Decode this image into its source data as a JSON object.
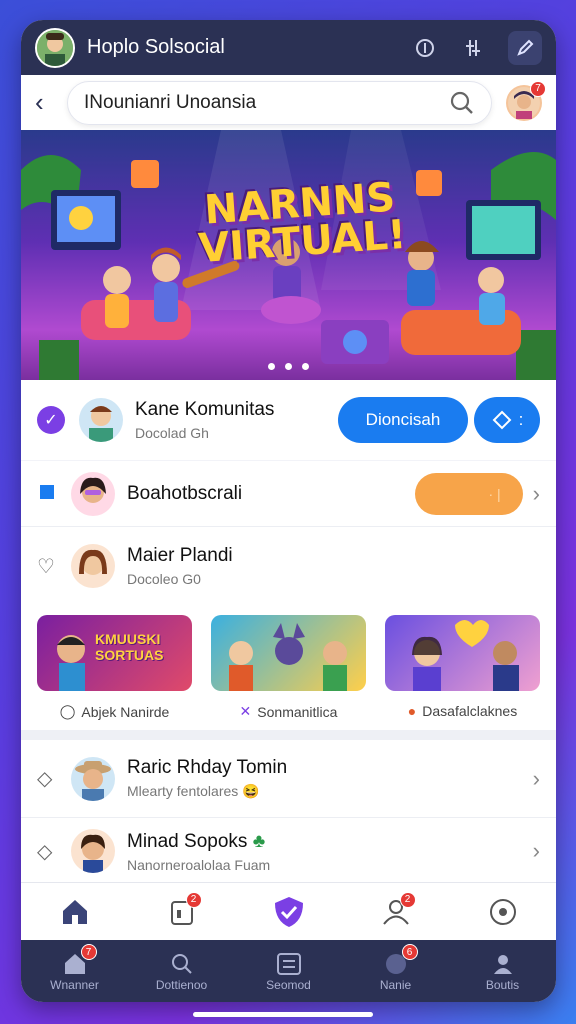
{
  "header": {
    "title": "Hoplo Solsocial"
  },
  "search": {
    "value": "INounianri Unoansia",
    "avatar_badge": "7"
  },
  "banner": {
    "headline": "NARNNS VIRTUAL!"
  },
  "community": {
    "name": "Kane Komunitas",
    "sub": "Docolad Gh",
    "primary_button": "Dioncisah",
    "secondary_button": ":"
  },
  "list1": [
    {
      "name": "Boahotbscrali",
      "sub": ""
    },
    {
      "name": "Maier Plandi",
      "sub": "Docoleo G0"
    }
  ],
  "thumbs": [
    {
      "title": "KMUUSKI SORTUAS",
      "label": "Abjek Nanirde"
    },
    {
      "title": "",
      "label": "Sonmanitlica"
    },
    {
      "title": "",
      "label": "Dasafalclaknes"
    }
  ],
  "list2": [
    {
      "name": "Raric Rhday Tomin",
      "sub": "Mlearty fentolares"
    },
    {
      "name": "Minad Sopoks",
      "sub": "Nanorneroalolaa Fuam"
    }
  ],
  "bottomnav": {
    "badge_two": "2",
    "badge_four": "2"
  },
  "dock": [
    {
      "label": "Wnanner",
      "badge": "7"
    },
    {
      "label": "Dottienoo",
      "badge": ""
    },
    {
      "label": "Seomod",
      "badge": ""
    },
    {
      "label": "Nanie",
      "badge": "6"
    },
    {
      "label": "Boutis",
      "badge": ""
    }
  ],
  "colors": {
    "accent": "#7b3fe4",
    "primary": "#1a7cf0",
    "orange": "#f7a449",
    "dark": "#2b3154"
  }
}
